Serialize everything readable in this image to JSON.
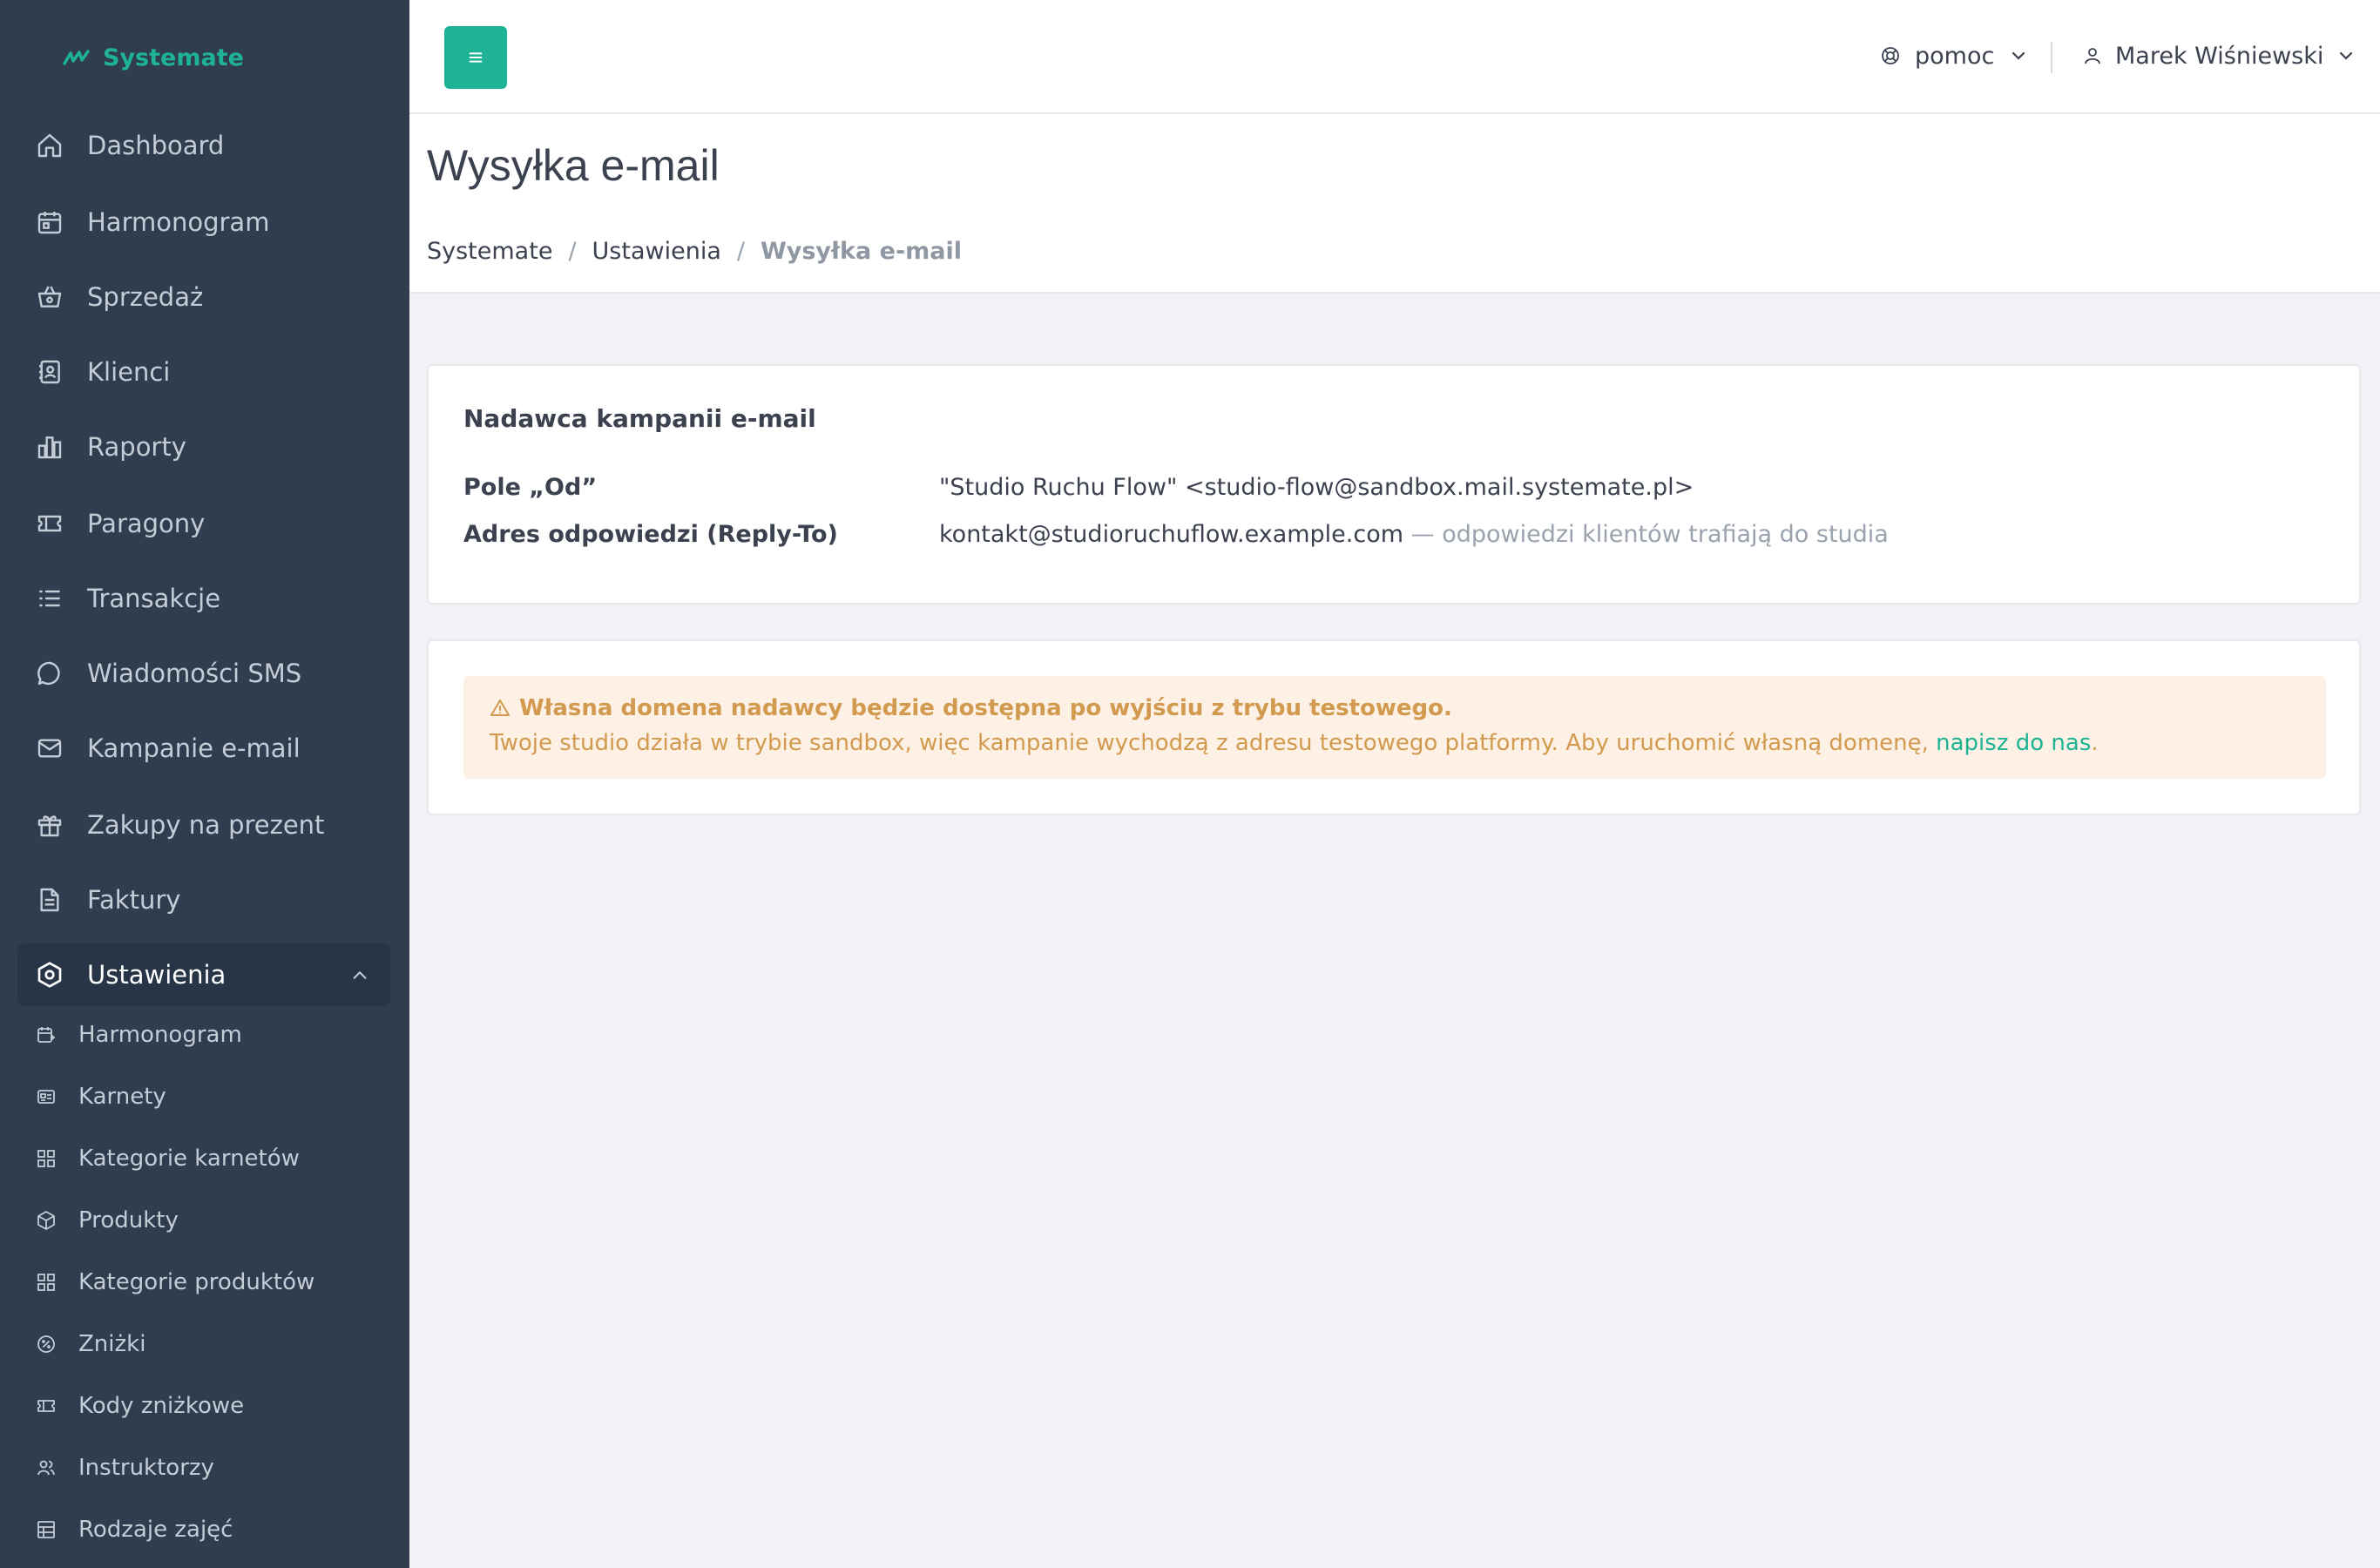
{
  "brand": {
    "name": "Systemate",
    "color": "#1db394"
  },
  "sidebar": {
    "items": [
      {
        "label": "Dashboard",
        "icon": "home-icon"
      },
      {
        "label": "Harmonogram",
        "icon": "calendar-icon"
      },
      {
        "label": "Sprzedaż",
        "icon": "basket-icon"
      },
      {
        "label": "Klienci",
        "icon": "contacts-icon"
      },
      {
        "label": "Raporty",
        "icon": "bar-chart-icon"
      },
      {
        "label": "Paragony",
        "icon": "receipt-icon"
      },
      {
        "label": "Transakcje",
        "icon": "list-icon"
      },
      {
        "label": "Wiadomości SMS",
        "icon": "chat-icon"
      },
      {
        "label": "Kampanie e-mail",
        "icon": "mail-icon"
      },
      {
        "label": "Zakupy na prezent",
        "icon": "gift-icon"
      },
      {
        "label": "Faktury",
        "icon": "document-icon"
      },
      {
        "label": "Ustawienia",
        "icon": "settings-icon",
        "active": true
      }
    ],
    "sub_items": [
      {
        "label": "Harmonogram",
        "icon": "calendar-edit-icon"
      },
      {
        "label": "Karnety",
        "icon": "card-icon"
      },
      {
        "label": "Kategorie karnetów",
        "icon": "grid-icon"
      },
      {
        "label": "Produkty",
        "icon": "box-icon"
      },
      {
        "label": "Kategorie produktów",
        "icon": "grid-icon"
      },
      {
        "label": "Zniżki",
        "icon": "percent-icon"
      },
      {
        "label": "Kody zniżkowe",
        "icon": "ticket-icon"
      },
      {
        "label": "Instruktorzy",
        "icon": "users-icon"
      },
      {
        "label": "Rodzaje zajęć",
        "icon": "table-icon"
      }
    ]
  },
  "topbar": {
    "help_label": "pomoc",
    "user_name": "Marek Wiśniewski"
  },
  "page": {
    "title": "Wysyłka e-mail",
    "breadcrumb": [
      "Systemate",
      "Ustawienia",
      "Wysyłka e-mail"
    ]
  },
  "sender_card": {
    "title": "Nadawca kampanii e-mail",
    "from_label": "Pole „Od”",
    "from_value": "\"Studio Ruchu Flow\" <studio-flow@sandbox.mail.systemate.pl>",
    "reply_label": "Adres odpowiedzi (Reply-To)",
    "reply_value": "kontakt@studioruchuflow.example.com",
    "reply_hint": " — odpowiedzi klientów trafiają do studia"
  },
  "alert": {
    "title": "Własna domena nadawcy będzie dostępna po wyjściu z trybu testowego.",
    "text": "Twoje studio działa w trybie sandbox, więc kampanie wychodzą z adresu testowego platformy. Aby uruchomić własną domenę, ",
    "link": "napisz do nas",
    "end": "."
  }
}
